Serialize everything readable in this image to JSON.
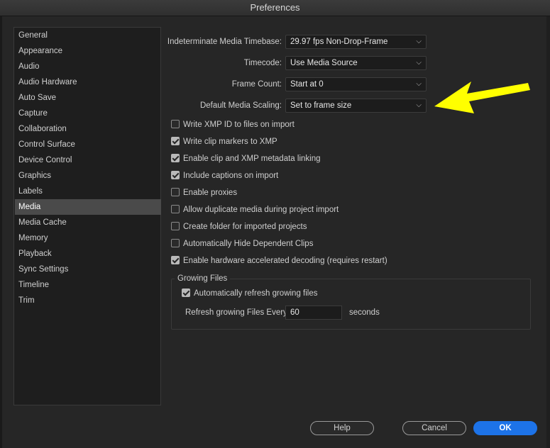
{
  "window": {
    "title": "Preferences"
  },
  "sidebar": {
    "items": [
      {
        "label": "General"
      },
      {
        "label": "Appearance"
      },
      {
        "label": "Audio"
      },
      {
        "label": "Audio Hardware"
      },
      {
        "label": "Auto Save"
      },
      {
        "label": "Capture"
      },
      {
        "label": "Collaboration"
      },
      {
        "label": "Control Surface"
      },
      {
        "label": "Device Control"
      },
      {
        "label": "Graphics"
      },
      {
        "label": "Labels"
      },
      {
        "label": "Media",
        "selected": true
      },
      {
        "label": "Media Cache"
      },
      {
        "label": "Memory"
      },
      {
        "label": "Playback"
      },
      {
        "label": "Sync Settings"
      },
      {
        "label": "Timeline"
      },
      {
        "label": "Trim"
      }
    ]
  },
  "fields": {
    "timebase": {
      "label": "Indeterminate Media Timebase:",
      "value": "29.97 fps Non-Drop-Frame"
    },
    "timecode": {
      "label": "Timecode:",
      "value": "Use Media Source"
    },
    "frame_count": {
      "label": "Frame Count:",
      "value": "Start at 0"
    },
    "scaling": {
      "label": "Default Media Scaling:",
      "value": "Set to frame size"
    }
  },
  "checkboxes": [
    {
      "label": "Write XMP ID to files on import",
      "checked": false
    },
    {
      "label": "Write clip markers to XMP",
      "checked": true
    },
    {
      "label": "Enable clip and XMP metadata linking",
      "checked": true
    },
    {
      "label": "Include captions on import",
      "checked": true
    },
    {
      "label": "Enable proxies",
      "checked": false
    },
    {
      "label": "Allow duplicate media during project import",
      "checked": false
    },
    {
      "label": "Create folder for imported projects",
      "checked": false
    },
    {
      "label": "Automatically Hide Dependent Clips",
      "checked": false
    },
    {
      "label": "Enable hardware accelerated decoding (requires restart)",
      "checked": true
    }
  ],
  "growing_files": {
    "title": "Growing Files",
    "auto_refresh": {
      "label": "Automatically refresh growing files",
      "checked": true
    },
    "refresh_label": "Refresh growing Files Every",
    "refresh_value": "60",
    "refresh_unit": "seconds"
  },
  "buttons": {
    "help": "Help",
    "cancel": "Cancel",
    "ok": "OK"
  },
  "colors": {
    "accent": "#1d73e8",
    "annotation_arrow": "#ffff00"
  },
  "icons": {
    "dropdown": "chevron-down-icon",
    "annotation": "arrow-icon"
  }
}
